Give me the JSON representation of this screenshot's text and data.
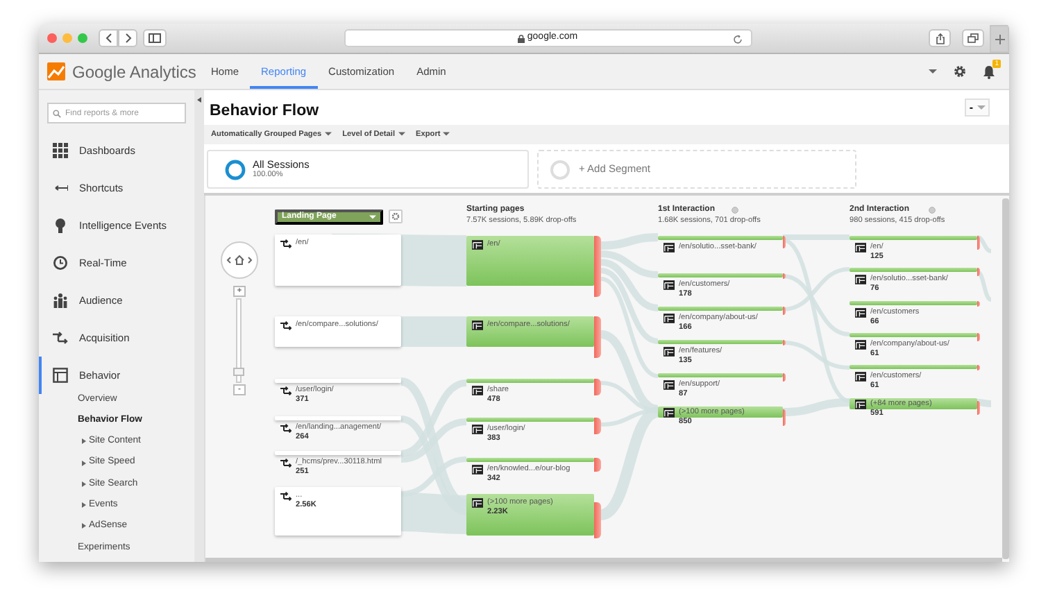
{
  "browser": {
    "url": "google.com"
  },
  "app": {
    "logo": "Google Analytics",
    "nav": [
      {
        "label": "Home",
        "selected": false
      },
      {
        "label": "Reporting",
        "selected": true
      },
      {
        "label": "Customization",
        "selected": false
      },
      {
        "label": "Admin",
        "selected": false
      }
    ],
    "notification_badge": "1"
  },
  "sidebar": {
    "search": {
      "placeholder": "Find reports & more"
    },
    "items": [
      {
        "label": "Dashboards",
        "selected": false
      },
      {
        "label": "Shortcuts",
        "selected": false
      },
      {
        "label": "Intelligence Events",
        "selected": false
      },
      {
        "label": "Real-Time",
        "selected": false
      },
      {
        "label": "Audience",
        "selected": false
      },
      {
        "label": "Acquisition",
        "selected": false
      },
      {
        "label": "Behavior",
        "selected": true,
        "expanded": true,
        "children": [
          {
            "label": "Overview",
            "kind": "link",
            "selected": false
          },
          {
            "label": "Behavior Flow",
            "kind": "link",
            "selected": true
          },
          {
            "label": "Site Content",
            "kind": "group",
            "selected": false
          },
          {
            "label": "Site Speed",
            "kind": "group",
            "selected": false
          },
          {
            "label": "Site Search",
            "kind": "group",
            "selected": false
          },
          {
            "label": "Events",
            "kind": "group",
            "selected": false
          },
          {
            "label": "AdSense",
            "kind": "group",
            "selected": false
          },
          {
            "label": "Experiments",
            "kind": "link",
            "selected": false
          }
        ]
      }
    ]
  },
  "report": {
    "title": "Behavior Flow",
    "view_control": "-",
    "toolbar": [
      "Automatically Grouped Pages",
      "Level of Detail",
      "Export"
    ],
    "segments": [
      {
        "kind": "active",
        "name": "All Sessions",
        "share": "100.00%"
      },
      {
        "kind": "add",
        "name": "+ Add Segment"
      }
    ]
  },
  "flow": {
    "dimension": "Landing Page",
    "zoom": {
      "zoom_in": "+",
      "zoom_out": "-",
      "level": 0.1
    },
    "landing_nodes": [
      {
        "page": "/en/"
      },
      {
        "page": "/en/compare...solutions/"
      },
      {
        "page": "/user/login/",
        "count": "371"
      },
      {
        "page": "/en/landing...anagement/",
        "count": "264"
      },
      {
        "page": "/_hcms/prev...30118.html",
        "count": "251"
      },
      {
        "page": "...",
        "count": "2.56K"
      }
    ],
    "steps": [
      {
        "title": "Starting pages",
        "summary": "7.57K sessions, 5.89K drop-offs",
        "nodes": [
          {
            "page": "/en/"
          },
          {
            "page": "/en/compare...solutions/"
          },
          {
            "page": "/share",
            "count": "478"
          },
          {
            "page": "/user/login/",
            "count": "383"
          },
          {
            "page": "/en/knowled...e/our-blog",
            "count": "342"
          },
          {
            "page": "(>100 more pages)",
            "count": "2.23K"
          }
        ]
      },
      {
        "title": "1st Interaction",
        "summary": "1.68K sessions, 701 drop-offs",
        "nodes": [
          {
            "page": "/en/solutio...sset-bank/"
          },
          {
            "page": "/en/customers/",
            "count": "178"
          },
          {
            "page": "/en/company/about-us/",
            "count": "166"
          },
          {
            "page": "/en/features/",
            "count": "135"
          },
          {
            "page": "/en/support/",
            "count": "87"
          },
          {
            "page": "(>100 more pages)",
            "count": "850"
          }
        ]
      },
      {
        "title": "2nd Interaction",
        "summary": "980 sessions, 415 drop-offs",
        "nodes": [
          {
            "page": "/en/",
            "count": "125"
          },
          {
            "page": "/en/solutio...sset-bank/",
            "count": "76"
          },
          {
            "page": "/en/customers",
            "count": "66"
          },
          {
            "page": "/en/company/about-us/",
            "count": "61"
          },
          {
            "page": "/en/customers/",
            "count": "61"
          },
          {
            "page": "(+84 more pages)",
            "count": "591"
          }
        ]
      }
    ]
  }
}
